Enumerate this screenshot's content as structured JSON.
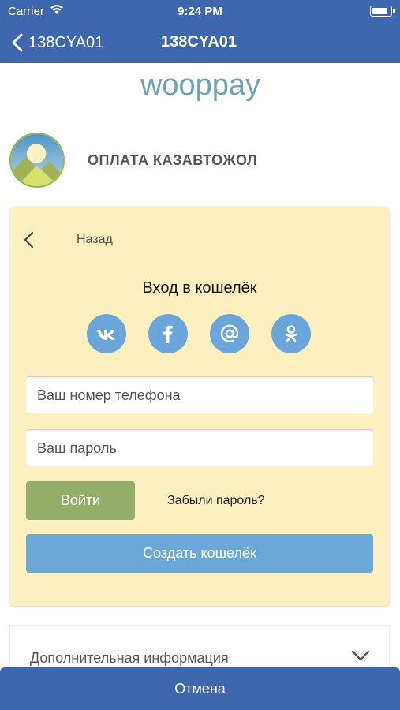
{
  "status_bar": {
    "carrier": "Carrier",
    "time": "9:24 PM",
    "battery_level": 0.9
  },
  "nav": {
    "back_label": "138CYA01",
    "title": "138CYA01"
  },
  "brand": {
    "logo_text": "wooppay"
  },
  "merchant": {
    "name": "ОПЛАТА КАЗАВТОЖОЛ"
  },
  "login": {
    "back_label": "Назад",
    "title": "Вход в кошелёк",
    "social_icons": [
      "vk-icon",
      "facebook-icon",
      "mail-at-icon",
      "odnoklassniki-icon"
    ],
    "phone_placeholder": "Ваш номер телефона",
    "phone_value": "",
    "password_placeholder": "Ваш пароль",
    "password_value": "",
    "login_button": "Войти",
    "forgot_link": "Забыли пароль?",
    "create_button": "Создать кошелёк"
  },
  "extra_info": {
    "label": "Дополнительная информация"
  },
  "footer": {
    "cancel_button": "Отмена"
  },
  "colors": {
    "primary": "#3f67ad",
    "card_bg": "#fdf0c0",
    "login_green": "#94ad69",
    "create_blue": "#6ba8d8",
    "social_blue": "#6aa6da"
  }
}
